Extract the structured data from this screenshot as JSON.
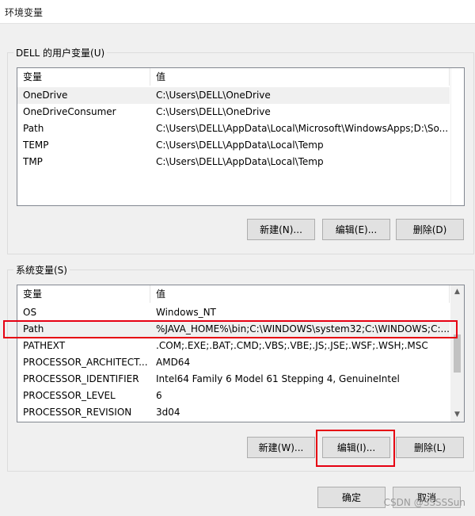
{
  "window": {
    "title": "环境变量"
  },
  "user_vars": {
    "group_label": "DELL 的用户变量(U)",
    "columns": [
      "变量",
      "值"
    ],
    "rows": [
      {
        "name": "OneDrive",
        "value": "C:\\Users\\DELL\\OneDrive"
      },
      {
        "name": "OneDriveConsumer",
        "value": "C:\\Users\\DELL\\OneDrive"
      },
      {
        "name": "Path",
        "value": "C:\\Users\\DELL\\AppData\\Local\\Microsoft\\WindowsApps;D:\\So..."
      },
      {
        "name": "TEMP",
        "value": "C:\\Users\\DELL\\AppData\\Local\\Temp"
      },
      {
        "name": "TMP",
        "value": "C:\\Users\\DELL\\AppData\\Local\\Temp"
      }
    ],
    "buttons": {
      "new": "新建(N)...",
      "edit": "编辑(E)...",
      "delete": "删除(D)"
    }
  },
  "system_vars": {
    "group_label": "系统变量(S)",
    "columns": [
      "变量",
      "值"
    ],
    "rows": [
      {
        "name": "OS",
        "value": "Windows_NT"
      },
      {
        "name": "Path",
        "value": "%JAVA_HOME%\\bin;C:\\WINDOWS\\system32;C:\\WINDOWS;C:..."
      },
      {
        "name": "PATHEXT",
        "value": ".COM;.EXE;.BAT;.CMD;.VBS;.VBE;.JS;.JSE;.WSF;.WSH;.MSC"
      },
      {
        "name": "PROCESSOR_ARCHITECT...",
        "value": "AMD64"
      },
      {
        "name": "PROCESSOR_IDENTIFIER",
        "value": "Intel64 Family 6 Model 61 Stepping 4, GenuineIntel"
      },
      {
        "name": "PROCESSOR_LEVEL",
        "value": "6"
      },
      {
        "name": "PROCESSOR_REVISION",
        "value": "3d04"
      }
    ],
    "buttons": {
      "new": "新建(W)...",
      "edit": "编辑(I)...",
      "delete": "删除(L)"
    }
  },
  "footer": {
    "ok": "确定",
    "cancel": "取消"
  },
  "watermark": "CSDN @SSSSSun",
  "colors": {
    "highlight": "#e60012",
    "list_border": "#828790",
    "button_bg": "#e1e1e1"
  },
  "icons": {
    "scroll_up": "▲",
    "scroll_down": "▼"
  }
}
